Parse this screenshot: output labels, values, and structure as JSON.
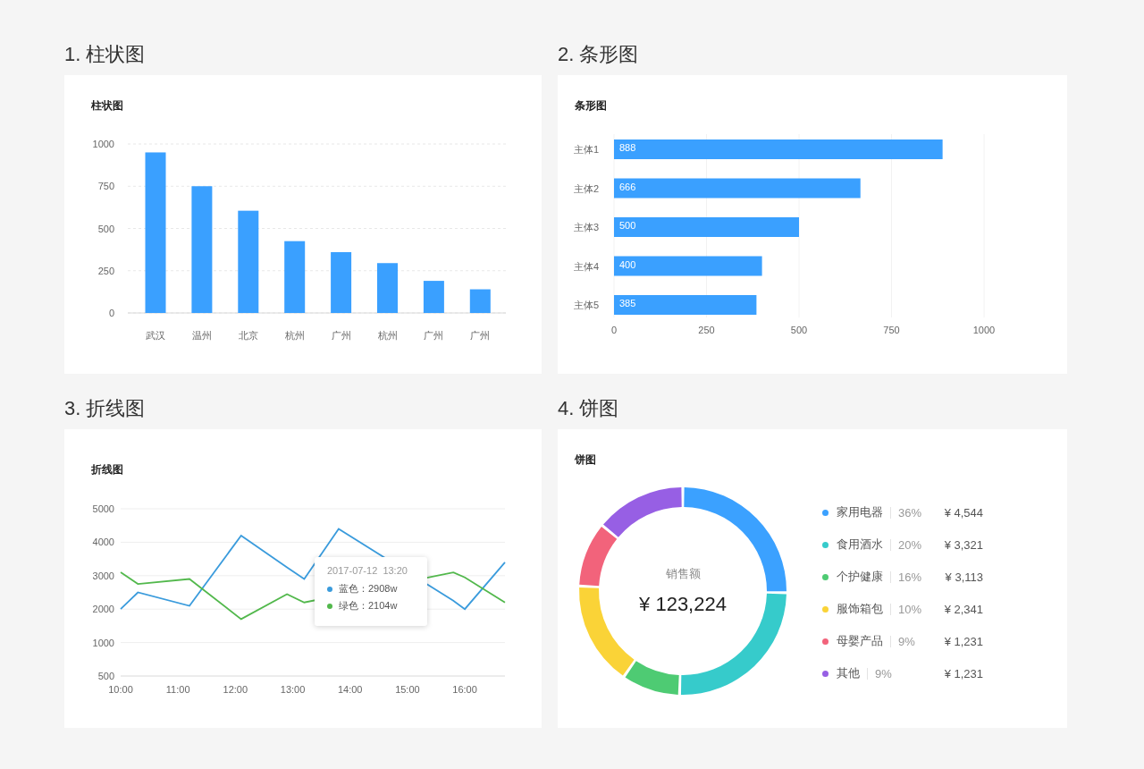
{
  "bar_panel": {
    "heading": "1. 柱状图",
    "title": "柱状图",
    "chart_data": {
      "type": "bar",
      "categories": [
        "武汉",
        "温州",
        "北京",
        "杭州",
        "广州",
        "杭州",
        "广州",
        "广州"
      ],
      "series": [
        {
          "color": "#3aa0ff",
          "values": [
            950,
            750,
            605,
            425,
            360,
            295,
            190,
            140
          ]
        }
      ],
      "ylim": [
        0,
        1000
      ],
      "yticks": [
        0,
        250,
        500,
        750,
        1000
      ],
      "grid": true
    }
  },
  "hbar_panel": {
    "heading": "2. 条形图",
    "title": "条形图",
    "chart_data": {
      "type": "bar",
      "orientation": "horizontal",
      "categories": [
        "主体1",
        "主体2",
        "主体3",
        "主体4",
        "主体5"
      ],
      "series": [
        {
          "color": "#3aa0ff",
          "values": [
            888,
            666,
            500,
            400,
            385
          ]
        }
      ],
      "xlim": [
        0,
        1000
      ],
      "xticks": [
        0,
        250,
        500,
        750,
        1000
      ],
      "data_labels": true,
      "grid": true
    }
  },
  "line_panel": {
    "heading": "3. 折线图",
    "title": "折线图",
    "chart_data": {
      "type": "line",
      "x": [
        10,
        10.3,
        11.2,
        12.1,
        12.9,
        13.2,
        13.8,
        15.8,
        16,
        16.7
      ],
      "series": [
        {
          "name": "蓝色",
          "color": "#3a9bdc",
          "values": [
            2000,
            2500,
            2100,
            4200,
            3250,
            2900,
            4400,
            2250,
            2000,
            3400
          ]
        },
        {
          "name": "绿色",
          "color": "#52b84c",
          "values": [
            3100,
            2750,
            2900,
            1700,
            2450,
            2200,
            null,
            3100,
            2950,
            2200
          ]
        }
      ],
      "xlim": [
        10,
        16.7
      ],
      "ylim": [
        0,
        5000
      ],
      "yticks": [
        1000,
        2000,
        3000,
        4000,
        5000
      ],
      "xticks": [
        {
          "value": 10,
          "label": "10:00"
        },
        {
          "value": 11,
          "label": "11:00"
        },
        {
          "value": 12,
          "label": "12:00"
        },
        {
          "value": 13,
          "label": "13:00"
        },
        {
          "value": 14,
          "label": "14:00"
        },
        {
          "value": 15,
          "label": "15:00"
        },
        {
          "value": 16,
          "label": "16:00"
        }
      ],
      "grid": true
    },
    "axis_bottom_label": "500",
    "tooltip": {
      "title": "2017-07-12  13:20",
      "items": [
        {
          "value": "：2908w"
        },
        {
          "value": "：2104w"
        }
      ]
    }
  },
  "pie_panel": {
    "heading": "4. 饼图",
    "title": "饼图",
    "chart_data": {
      "type": "donut",
      "categories": [
        "家用电器",
        "食用酒水",
        "个护健康",
        "服饰箱包",
        "母婴产品",
        "其他"
      ],
      "values": [
        25,
        25,
        9,
        16,
        10,
        14
      ]
    },
    "center": {
      "label": "销售额",
      "value": "¥ 123,224"
    },
    "legend": [
      {
        "percent": "36%",
        "amount": "¥ 4,544",
        "color": "#3ba1ff"
      },
      {
        "percent": "20%",
        "amount": "¥ 3,321",
        "color": "#36cbcb"
      },
      {
        "percent": "16%",
        "amount": "¥ 3,113",
        "color": "#4ecb73"
      },
      {
        "percent": "10%",
        "amount": "¥ 2,341",
        "color": "#fad337"
      },
      {
        "percent": "9%",
        "amount": "¥ 1,231",
        "color": "#f2637b"
      },
      {
        "percent": "9%",
        "amount": "¥ 1,231",
        "color": "#975fe4"
      }
    ]
  }
}
